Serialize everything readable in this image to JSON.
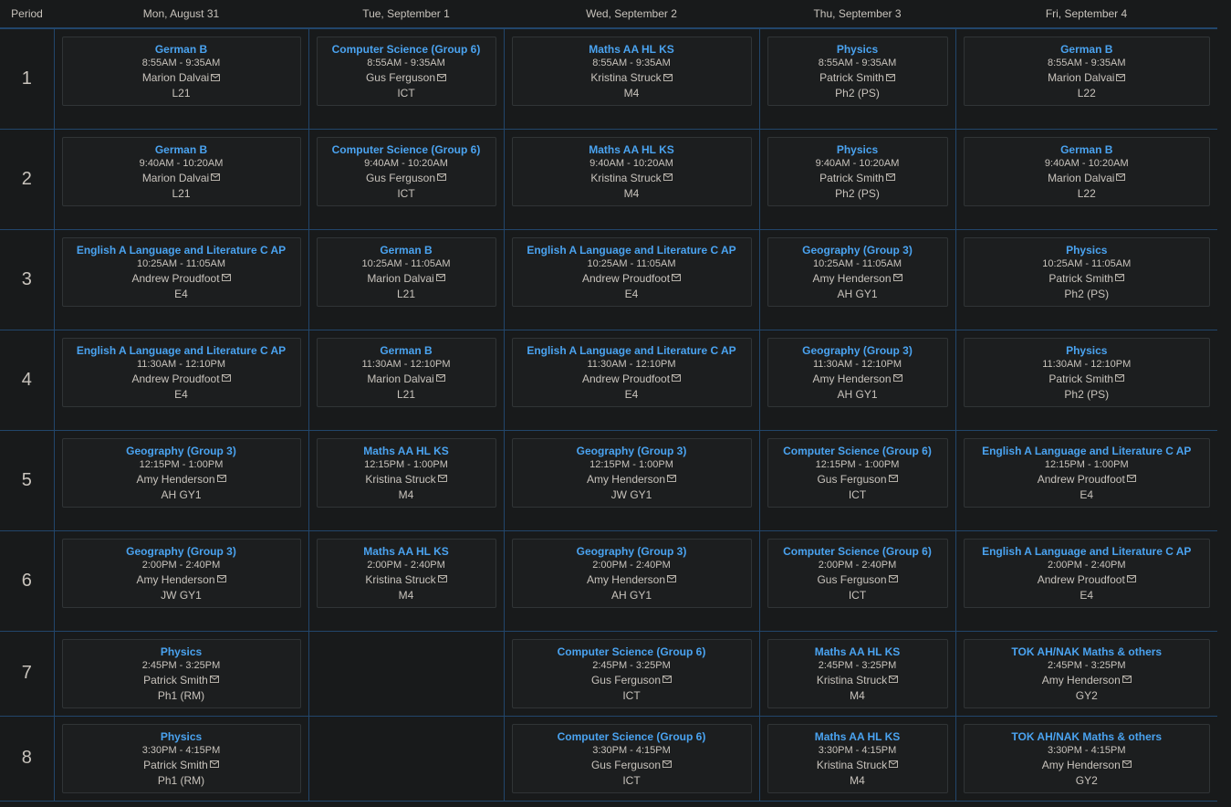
{
  "headers": {
    "period": "Period",
    "days": [
      "Mon, August 31",
      "Tue, September 1",
      "Wed, September 2",
      "Thu, September 3",
      "Fri, September 4"
    ]
  },
  "colors": {
    "subject_link": "#4aa3f0",
    "grid_line": "#22466b",
    "background": "#181a1b",
    "card_background": "#1c1e1f"
  },
  "icons": {
    "teacher_contact": "mail-icon"
  },
  "rows": [
    {
      "period": "1",
      "cells": [
        {
          "subject": "German B",
          "time": "8:55AM - 9:35AM",
          "teacher": "Marion Dalvai",
          "room": "L21"
        },
        {
          "subject": "Computer Science (Group 6)",
          "time": "8:55AM - 9:35AM",
          "teacher": "Gus Ferguson",
          "room": "ICT"
        },
        {
          "subject": "Maths AA HL KS",
          "time": "8:55AM - 9:35AM",
          "teacher": "Kristina Struck",
          "room": "M4"
        },
        {
          "subject": "Physics",
          "time": "8:55AM - 9:35AM",
          "teacher": "Patrick Smith",
          "room": "Ph2 (PS)"
        },
        {
          "subject": "German B",
          "time": "8:55AM - 9:35AM",
          "teacher": "Marion Dalvai",
          "room": "L22"
        }
      ]
    },
    {
      "period": "2",
      "cells": [
        {
          "subject": "German B",
          "time": "9:40AM - 10:20AM",
          "teacher": "Marion Dalvai",
          "room": "L21"
        },
        {
          "subject": "Computer Science (Group 6)",
          "time": "9:40AM - 10:20AM",
          "teacher": "Gus Ferguson",
          "room": "ICT"
        },
        {
          "subject": "Maths AA HL KS",
          "time": "9:40AM - 10:20AM",
          "teacher": "Kristina Struck",
          "room": "M4"
        },
        {
          "subject": "Physics",
          "time": "9:40AM - 10:20AM",
          "teacher": "Patrick Smith",
          "room": "Ph2 (PS)"
        },
        {
          "subject": "German B",
          "time": "9:40AM - 10:20AM",
          "teacher": "Marion Dalvai",
          "room": "L22"
        }
      ]
    },
    {
      "period": "3",
      "cells": [
        {
          "subject": "English A Language and Literature C AP",
          "time": "10:25AM - 11:05AM",
          "teacher": "Andrew Proudfoot",
          "room": "E4"
        },
        {
          "subject": "German B",
          "time": "10:25AM - 11:05AM",
          "teacher": "Marion Dalvai",
          "room": "L21"
        },
        {
          "subject": "English A Language and Literature C AP",
          "time": "10:25AM - 11:05AM",
          "teacher": "Andrew Proudfoot",
          "room": "E4"
        },
        {
          "subject": "Geography (Group 3)",
          "time": "10:25AM - 11:05AM",
          "teacher": "Amy Henderson",
          "room": "AH GY1"
        },
        {
          "subject": "Physics",
          "time": "10:25AM - 11:05AM",
          "teacher": "Patrick Smith",
          "room": "Ph2 (PS)"
        }
      ]
    },
    {
      "period": "4",
      "cells": [
        {
          "subject": "English A Language and Literature C AP",
          "time": "11:30AM - 12:10PM",
          "teacher": "Andrew Proudfoot",
          "room": "E4"
        },
        {
          "subject": "German B",
          "time": "11:30AM - 12:10PM",
          "teacher": "Marion Dalvai",
          "room": "L21"
        },
        {
          "subject": "English A Language and Literature C AP",
          "time": "11:30AM - 12:10PM",
          "teacher": "Andrew Proudfoot",
          "room": "E4"
        },
        {
          "subject": "Geography (Group 3)",
          "time": "11:30AM - 12:10PM",
          "teacher": "Amy Henderson",
          "room": "AH GY1"
        },
        {
          "subject": "Physics",
          "time": "11:30AM - 12:10PM",
          "teacher": "Patrick Smith",
          "room": "Ph2 (PS)"
        }
      ]
    },
    {
      "period": "5",
      "cells": [
        {
          "subject": "Geography (Group 3)",
          "time": "12:15PM - 1:00PM",
          "teacher": "Amy Henderson",
          "room": "AH GY1"
        },
        {
          "subject": "Maths AA HL KS",
          "time": "12:15PM - 1:00PM",
          "teacher": "Kristina Struck",
          "room": "M4"
        },
        {
          "subject": "Geography (Group 3)",
          "time": "12:15PM - 1:00PM",
          "teacher": "Amy Henderson",
          "room": "JW GY1"
        },
        {
          "subject": "Computer Science (Group 6)",
          "time": "12:15PM - 1:00PM",
          "teacher": "Gus Ferguson",
          "room": "ICT"
        },
        {
          "subject": "English A Language and Literature C AP",
          "time": "12:15PM - 1:00PM",
          "teacher": "Andrew Proudfoot",
          "room": "E4"
        }
      ]
    },
    {
      "period": "6",
      "cells": [
        {
          "subject": "Geography (Group 3)",
          "time": "2:00PM - 2:40PM",
          "teacher": "Amy Henderson",
          "room": "JW GY1"
        },
        {
          "subject": "Maths AA HL KS",
          "time": "2:00PM - 2:40PM",
          "teacher": "Kristina Struck",
          "room": "M4"
        },
        {
          "subject": "Geography (Group 3)",
          "time": "2:00PM - 2:40PM",
          "teacher": "Amy Henderson",
          "room": "AH GY1"
        },
        {
          "subject": "Computer Science (Group 6)",
          "time": "2:00PM - 2:40PM",
          "teacher": "Gus Ferguson",
          "room": "ICT"
        },
        {
          "subject": "English A Language and Literature C AP",
          "time": "2:00PM - 2:40PM",
          "teacher": "Andrew Proudfoot",
          "room": "E4"
        }
      ]
    },
    {
      "period": "7",
      "cells": [
        {
          "subject": "Physics",
          "time": "2:45PM - 3:25PM",
          "teacher": "Patrick Smith",
          "room": "Ph1 (RM)"
        },
        null,
        {
          "subject": "Computer Science (Group 6)",
          "time": "2:45PM - 3:25PM",
          "teacher": "Gus Ferguson",
          "room": "ICT"
        },
        {
          "subject": "Maths AA HL KS",
          "time": "2:45PM - 3:25PM",
          "teacher": "Kristina Struck",
          "room": "M4"
        },
        {
          "subject": "TOK AH/NAK Maths & others",
          "time": "2:45PM - 3:25PM",
          "teacher": "Amy Henderson",
          "room": "GY2"
        }
      ]
    },
    {
      "period": "8",
      "cells": [
        {
          "subject": "Physics",
          "time": "3:30PM - 4:15PM",
          "teacher": "Patrick Smith",
          "room": "Ph1 (RM)"
        },
        null,
        {
          "subject": "Computer Science (Group 6)",
          "time": "3:30PM - 4:15PM",
          "teacher": "Gus Ferguson",
          "room": "ICT"
        },
        {
          "subject": "Maths AA HL KS",
          "time": "3:30PM - 4:15PM",
          "teacher": "Kristina Struck",
          "room": "M4"
        },
        {
          "subject": "TOK AH/NAK Maths & others",
          "time": "3:30PM - 4:15PM",
          "teacher": "Amy Henderson",
          "room": "GY2"
        }
      ]
    }
  ]
}
